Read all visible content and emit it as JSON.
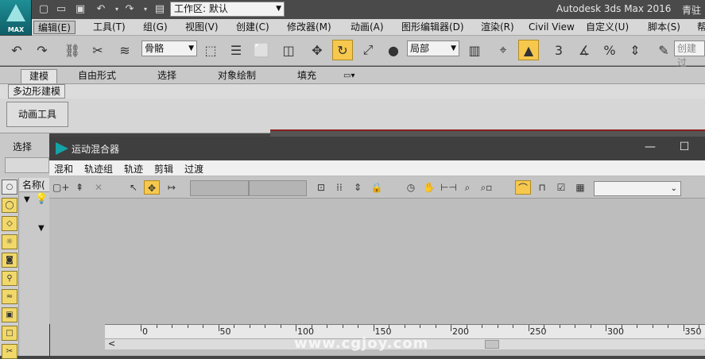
{
  "app": {
    "title": "Autodesk 3ds Max 2016",
    "user": "青驻",
    "logo_text": "MAX",
    "workspace_label": "工作区: 默认"
  },
  "menubar": {
    "items": [
      "编辑(E)",
      "工具(T)",
      "组(G)",
      "视图(V)",
      "创建(C)",
      "修改器(M)",
      "动画(A)",
      "图形编辑器(D)",
      "渲染(R)",
      "Civil View",
      "自定义(U)",
      "脚本(S)",
      "帮"
    ],
    "active_index": 0
  },
  "toolbar": {
    "selection_filter": "骨骼",
    "coord_system": "局部",
    "search_placeholder": "创建过"
  },
  "ribbon": {
    "tabs": [
      "建模",
      "自由形式",
      "选择",
      "对象绘制",
      "填充"
    ],
    "active_tab": "建模",
    "subtab": "多边形建模",
    "panel_button": "动画工具"
  },
  "left_panel": {
    "select_label": "选择",
    "name_header": "名称("
  },
  "mixer": {
    "title": "运动混合器",
    "menu": [
      "混和",
      "轨迹组",
      "轨迹",
      "剪辑",
      "过渡"
    ],
    "ruler_ticks": [
      "0",
      "50",
      "100",
      "150",
      "200",
      "250",
      "300",
      "350"
    ]
  },
  "watermark": "www.cgjoy.com",
  "colors": {
    "accent": "#f6c84d",
    "teal_logo": "#14a3a8",
    "titlebar": "#3f3f3f"
  }
}
